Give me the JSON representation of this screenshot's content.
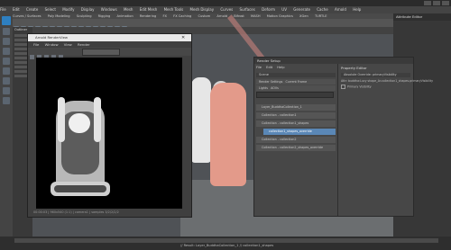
{
  "app": {
    "menu": [
      "File",
      "Edit",
      "Create",
      "Select",
      "Modify",
      "Display",
      "Windows",
      "Mesh",
      "Edit Mesh",
      "Mesh Tools",
      "Mesh Display",
      "Curves",
      "Surfaces",
      "Deform",
      "UV",
      "Generate",
      "Cache",
      "Arnold",
      "Help"
    ],
    "shelf_tabs": [
      "Curves / Surfaces",
      "Poly Modeling",
      "Sculpting",
      "Rigging",
      "Animation",
      "Rendering",
      "FX",
      "FX Caching",
      "Custom",
      "Arnold",
      "Bifrost",
      "MASH",
      "Motion Graphics",
      "XGen",
      "TURTLE"
    ],
    "outliner_title": "Outliner",
    "right_panel_title": "Attribute Editor"
  },
  "render_window": {
    "title": "Arnold RenderView",
    "menu": [
      "File",
      "Window",
      "View",
      "Render"
    ],
    "footer": "00:00:03 | 960x540 (1:1) | camera1 | samples 3/2/2/2/2"
  },
  "render_setup": {
    "title": "Render Setup",
    "menu": [
      "File",
      "Edit",
      "Help"
    ],
    "scene": "Scene",
    "render_settings": "Render Settings",
    "current_frame": "Current Frame",
    "lights": "Lights",
    "aovs": "AOVs",
    "layers": [
      {
        "label": "Layer_BuddhaCollection_1",
        "selected": false
      },
      {
        "label": "Collection - collection1",
        "selected": false
      },
      {
        "label": "Collection - collection1_shapes",
        "selected": false
      },
      {
        "label": "collection1_shapes_override",
        "selected": true
      },
      {
        "label": "Collection - collection2",
        "selected": false
      },
      {
        "label": "Collection - collection2_shapes_override",
        "selected": false
      }
    ]
  },
  "property_editor": {
    "title": "Property Editor",
    "row": "Absolute Override: primaryVisibility",
    "lines": [
      "Attr: buddha:Lucy shape_Ar.collection1_shapes.primaryVisibility",
      "Primary Visibility"
    ]
  },
  "status": {
    "text": "// Result: Layer_BuddhaCollection_1 // collection1_shapes"
  }
}
